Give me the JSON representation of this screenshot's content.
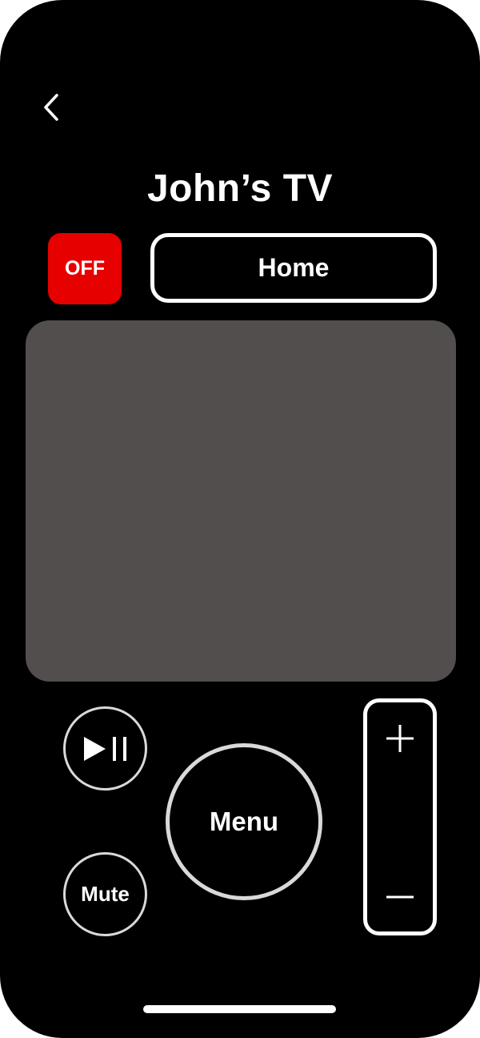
{
  "header": {
    "back_icon": "chevron-left-icon",
    "title": "John’s TV"
  },
  "controls": {
    "power_label": "OFF",
    "power_color": "#e60000",
    "home_label": "Home",
    "touchpad_color": "#514e4d",
    "play_pause_icon": "play-pause-icon",
    "menu_label": "Menu",
    "mute_label": "Mute",
    "volume_up_icon": "plus-icon",
    "volume_down_icon": "minus-icon"
  }
}
